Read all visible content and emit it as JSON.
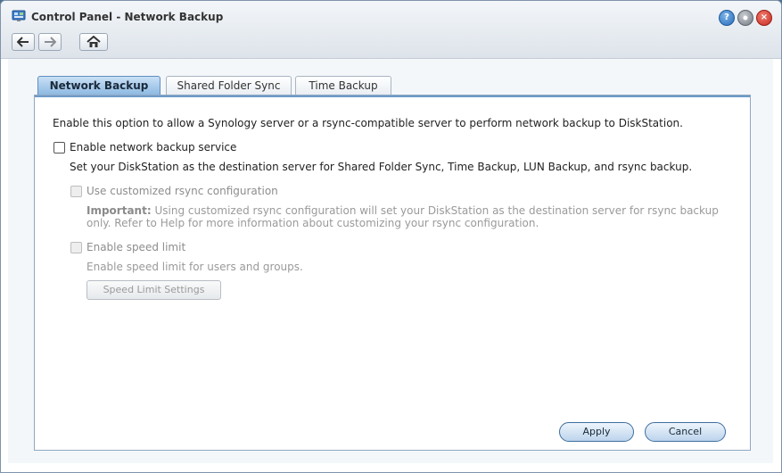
{
  "window": {
    "title": "Control Panel - Network Backup",
    "buttons": {
      "help": "?",
      "minimize": "",
      "close": "×"
    }
  },
  "tabs": [
    {
      "label": "Network Backup",
      "active": true
    },
    {
      "label": "Shared Folder Sync",
      "active": false
    },
    {
      "label": "Time Backup",
      "active": false
    }
  ],
  "content": {
    "intro": "Enable this option to allow a Synology server or a rsync-compatible server to perform network backup to DiskStation.",
    "enable_service": {
      "label": "Enable network backup service",
      "checked": false,
      "description": "Set your DiskStation as the destination server for Shared Folder Sync, Time Backup, LUN Backup, and rsync backup."
    },
    "custom_rsync": {
      "label": "Use customized rsync configuration",
      "important_label": "Important:",
      "important_text": "Using customized rsync configuration will set your DiskStation as the destination server for rsync backup only. Refer to Help for more information about customizing your rsync configuration."
    },
    "speed_limit": {
      "label": "Enable speed limit",
      "description": "Enable speed limit for users and groups.",
      "settings_button": "Speed Limit Settings"
    }
  },
  "actions": {
    "apply": "Apply",
    "cancel": "Cancel"
  },
  "colors": {
    "accent": "#6d9ac8",
    "active_tab": "#88b5e0",
    "disabled_text": "#8d8d8d"
  }
}
